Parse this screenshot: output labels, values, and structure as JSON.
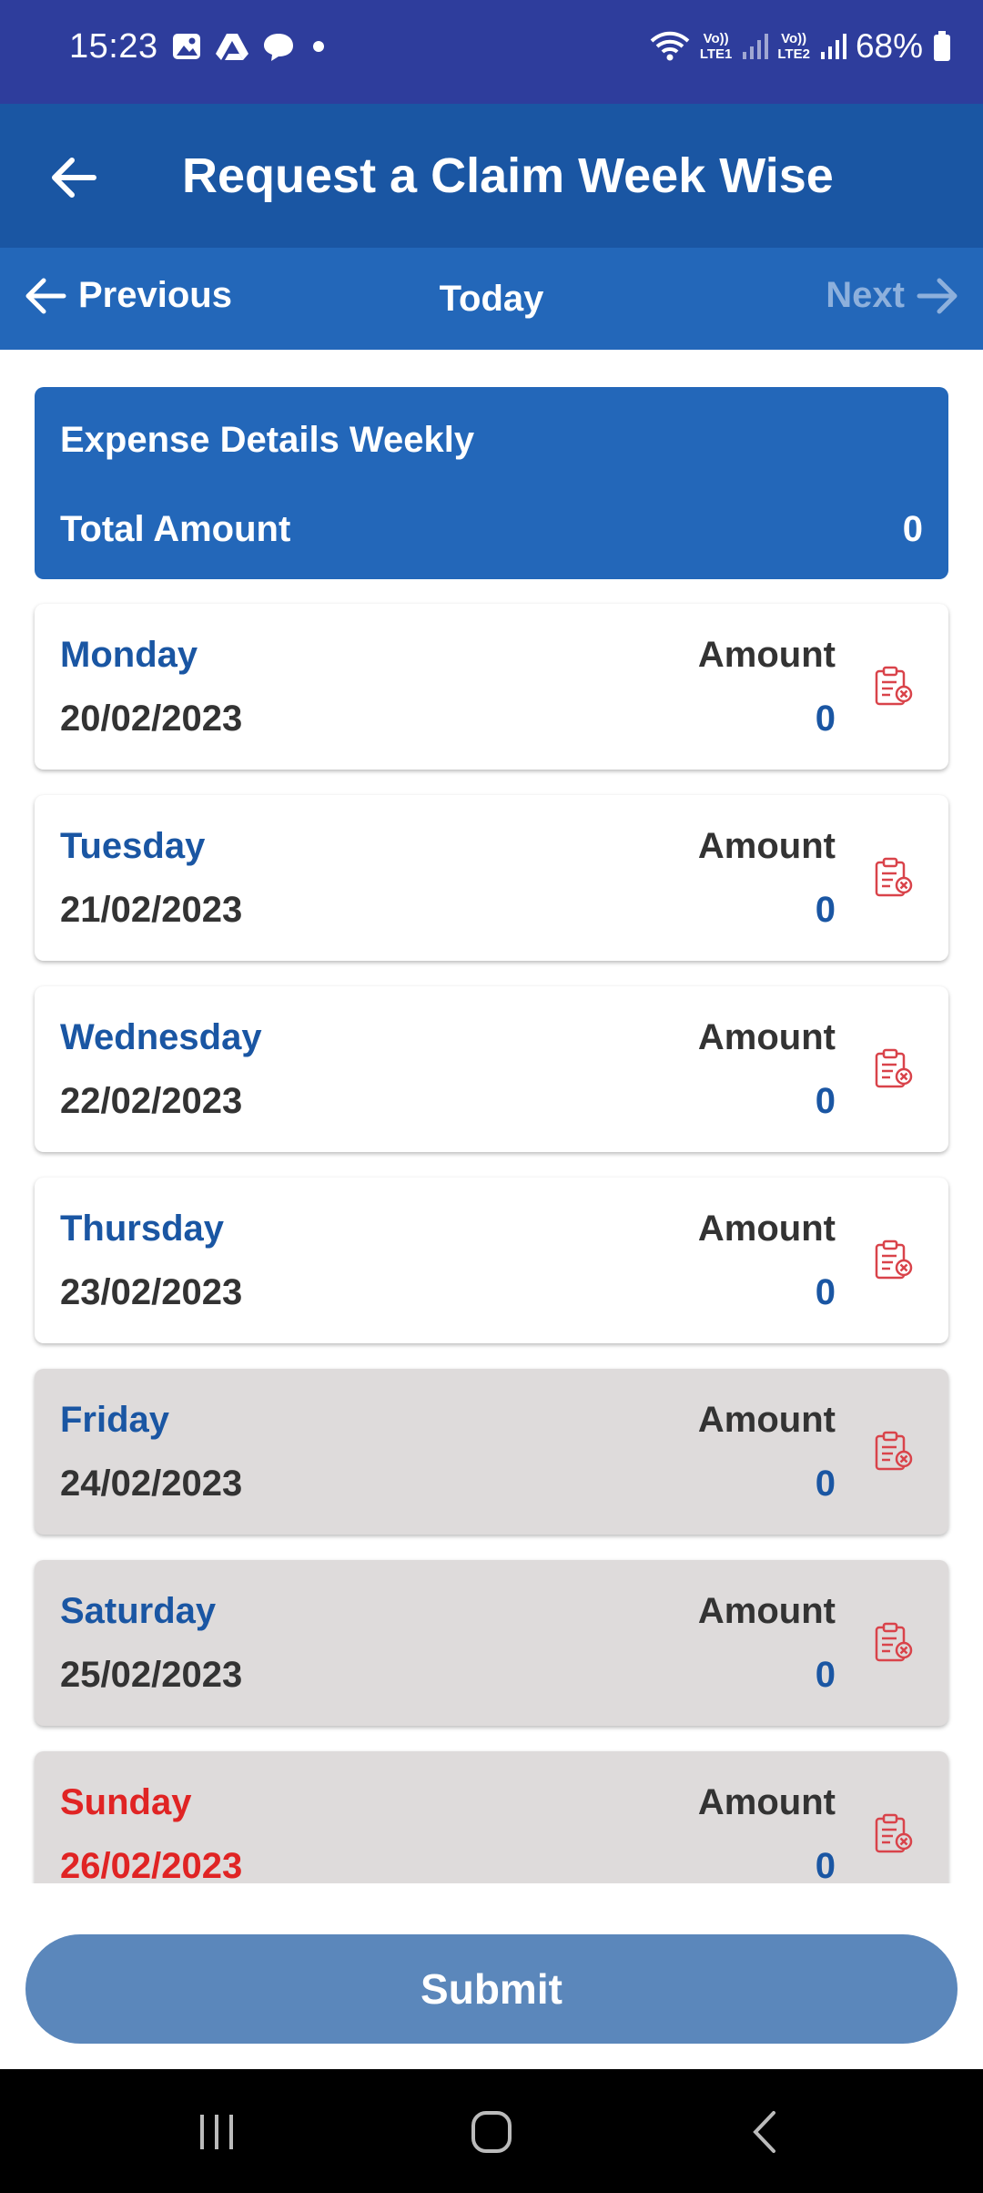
{
  "status_bar": {
    "time": "15:23",
    "battery": "68%",
    "left_icons": [
      "image-icon",
      "drive-icon",
      "chat-icon",
      "dot-icon"
    ],
    "right_icons": [
      "wifi-icon",
      "volte-lte1-icon",
      "signal-icon",
      "volte-lte2-icon",
      "signal-icon",
      "battery-icon"
    ],
    "volte1": "Vo))",
    "lte1": "LTE1",
    "volte2": "Vo))",
    "lte2": "LTE2"
  },
  "app_bar": {
    "title": "Request a Claim Week Wise",
    "back_icon": "arrow-left-icon"
  },
  "nav": {
    "previous": "Previous",
    "today": "Today",
    "next": "Next"
  },
  "summary": {
    "title": "Expense Details Weekly",
    "total_label": "Total Amount",
    "total_value": "0"
  },
  "days": [
    {
      "day": "Monday",
      "date": "20/02/2023",
      "amount_label": "Amount",
      "amount": "0",
      "weekend": false
    },
    {
      "day": "Tuesday",
      "date": "21/02/2023",
      "amount_label": "Amount",
      "amount": "0",
      "weekend": false
    },
    {
      "day": "Wednesday",
      "date": "22/02/2023",
      "amount_label": "Amount",
      "amount": "0",
      "weekend": false
    },
    {
      "day": "Thursday",
      "date": "23/02/2023",
      "amount_label": "Amount",
      "amount": "0",
      "weekend": false
    },
    {
      "day": "Friday",
      "date": "24/02/2023",
      "amount_label": "Amount",
      "amount": "0",
      "weekend": true
    },
    {
      "day": "Saturday",
      "date": "25/02/2023",
      "amount_label": "Amount",
      "amount": "0",
      "weekend": true
    },
    {
      "day": "Sunday",
      "date": "26/02/2023",
      "amount_label": "Amount",
      "amount": "0",
      "weekend": true
    }
  ],
  "card_icon": "clipboard-remove-icon",
  "submit_label": "Submit",
  "colors": {
    "status_bar": "#2e3d9c",
    "app_bar": "#1a56a3",
    "nav_bar": "#2367b9",
    "summary": "#2367b9",
    "day_text": "#1a56a3",
    "sunday_text": "#e02424",
    "weekend_card": "#dedbdb",
    "submit": "#5b87bb",
    "icon_red": "#d9434a"
  }
}
